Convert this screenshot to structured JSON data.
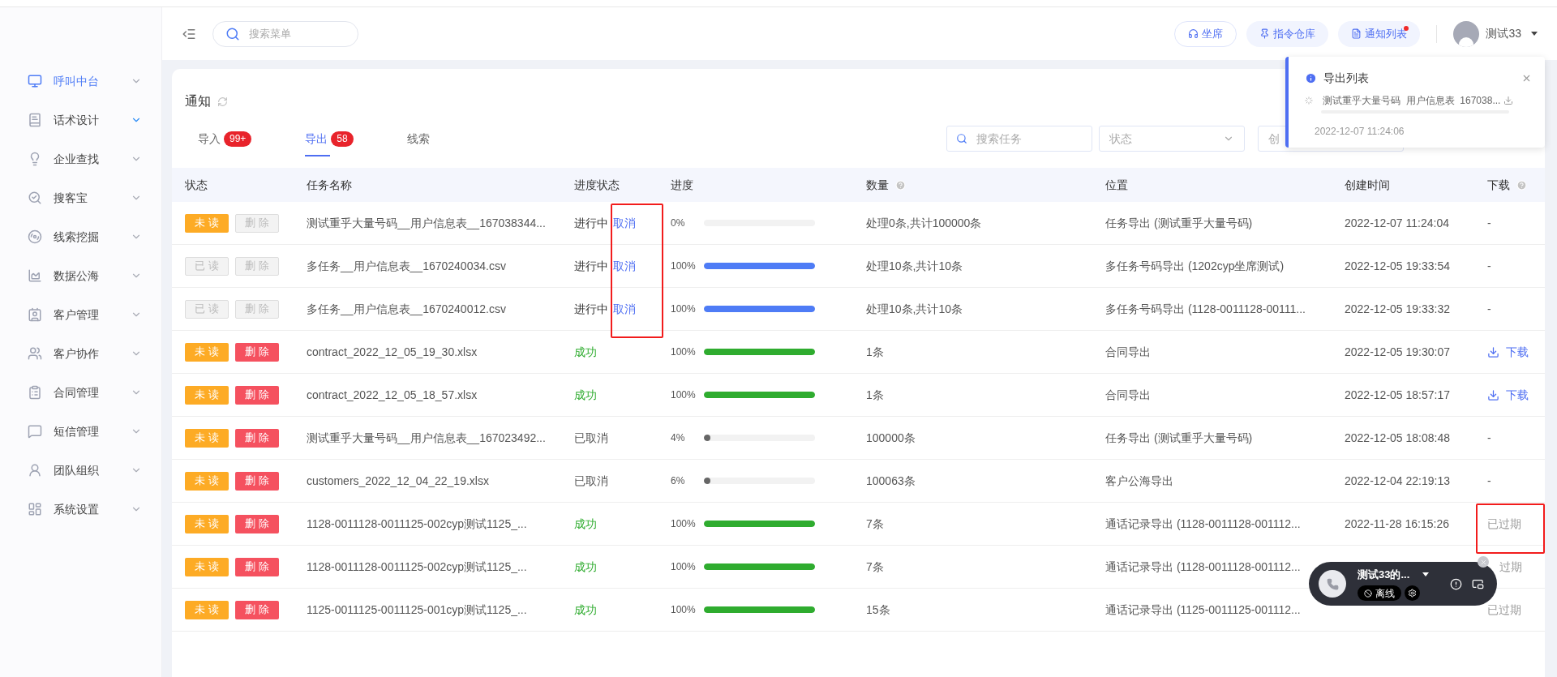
{
  "sidebar": {
    "items": [
      {
        "label": "呼叫中台",
        "selected": true,
        "chevron_highlighted": false
      },
      {
        "label": "话术设计",
        "selected": false,
        "chevron_highlighted": true
      },
      {
        "label": "企业查找",
        "selected": false,
        "chevron_highlighted": false
      },
      {
        "label": "搜客宝",
        "selected": false,
        "chevron_highlighted": false
      },
      {
        "label": "线索挖掘",
        "selected": false,
        "chevron_highlighted": false
      },
      {
        "label": "数据公海",
        "selected": false,
        "chevron_highlighted": false
      },
      {
        "label": "客户管理",
        "selected": false,
        "chevron_highlighted": false
      },
      {
        "label": "客户协作",
        "selected": false,
        "chevron_highlighted": false
      },
      {
        "label": "合同管理",
        "selected": false,
        "chevron_highlighted": false
      },
      {
        "label": "短信管理",
        "selected": false,
        "chevron_highlighted": false
      },
      {
        "label": "团队组织",
        "selected": false,
        "chevron_highlighted": false
      },
      {
        "label": "系统设置",
        "selected": false,
        "chevron_highlighted": false
      }
    ]
  },
  "header": {
    "search": {
      "placeholder": "搜索菜单"
    },
    "buttons": [
      {
        "label": "坐席",
        "kind": "outline",
        "dot": false
      },
      {
        "label": "指令仓库",
        "kind": "filled",
        "dot": false
      },
      {
        "label": "通知列表",
        "kind": "filled",
        "dot": true
      }
    ],
    "user": "测试33"
  },
  "page": {
    "title": "通知",
    "tabs": [
      {
        "label": "导入",
        "badge": "99+",
        "selected": false
      },
      {
        "label": "导出",
        "badge": "58",
        "selected": true
      },
      {
        "label": "线索",
        "selected": false
      }
    ],
    "filters": {
      "search": {
        "placeholder": "搜索任务"
      },
      "status": {
        "placeholder": "状态"
      },
      "date": {
        "placeholder": "创"
      }
    },
    "table": {
      "columns": [
        {
          "label": "状态"
        },
        {
          "label": "任务名称"
        },
        {
          "label": "进度状态"
        },
        {
          "label": "进度"
        },
        {
          "label": "数量",
          "help": true
        },
        {
          "label": "位置"
        },
        {
          "label": "创建时间"
        },
        {
          "label": "下载",
          "help": true
        }
      ],
      "rows": [
        {
          "read_label": "未读",
          "read": false,
          "delete_label": "删除",
          "delete_disabled": true,
          "name": "测试重乎大量号码__用户信息表__167038344...",
          "status": "进行中",
          "kind": "running",
          "cancel": "取消",
          "percent": "0%",
          "level": 0,
          "count": "处理0条,共计100000条",
          "location": "任务导出 (测试重乎大量号码)",
          "created": "2022-12-07 11:24:04",
          "download": {
            "kind": "none",
            "text": "-"
          }
        },
        {
          "read_label": "已读",
          "read": true,
          "delete_label": "删除",
          "delete_disabled": true,
          "name": "多任务__用户信息表__1670240034.csv",
          "status": "进行中",
          "kind": "running",
          "cancel": "取消",
          "percent": "100%",
          "level": 1,
          "count": "处理10条,共计10条",
          "location": "多任务号码导出 (1202cyp坐席测试)",
          "created": "2022-12-05 19:33:54",
          "download": {
            "kind": "none",
            "text": "-"
          }
        },
        {
          "read_label": "已读",
          "read": true,
          "delete_label": "删除",
          "delete_disabled": true,
          "name": "多任务__用户信息表__1670240012.csv",
          "status": "进行中",
          "kind": "running",
          "cancel": "取消",
          "percent": "100%",
          "level": 1,
          "count": "处理10条,共计10条",
          "location": "多任务号码导出 (1128-0011128-00111...",
          "created": "2022-12-05 19:33:32",
          "download": {
            "kind": "none",
            "text": "-"
          }
        },
        {
          "read_label": "未读",
          "read": false,
          "delete_label": "删除",
          "delete_disabled": false,
          "name": "contract_2022_12_05_19_30.xlsx",
          "status": "成功",
          "kind": "success",
          "percent": "100%",
          "level": 1,
          "count": "1条",
          "location": "合同导出",
          "created": "2022-12-05 19:30:07",
          "download": {
            "kind": "link",
            "text": "下载"
          }
        },
        {
          "read_label": "未读",
          "read": false,
          "delete_label": "删除",
          "delete_disabled": false,
          "name": "contract_2022_12_05_18_57.xlsx",
          "status": "成功",
          "kind": "success",
          "percent": "100%",
          "level": 1,
          "count": "1条",
          "location": "合同导出",
          "created": "2022-12-05 18:57:17",
          "download": {
            "kind": "link",
            "text": "下载"
          }
        },
        {
          "read_label": "未读",
          "read": false,
          "delete_label": "删除",
          "delete_disabled": false,
          "name": "测试重乎大量号码__用户信息表__167023492...",
          "status": "已取消",
          "kind": "cancelled",
          "percent": "4%",
          "level": 0.04,
          "count": "100000条",
          "location": "任务导出 (测试重乎大量号码)",
          "created": "2022-12-05 18:08:48",
          "download": {
            "kind": "none",
            "text": "-"
          }
        },
        {
          "read_label": "未读",
          "read": false,
          "delete_label": "删除",
          "delete_disabled": false,
          "name": "customers_2022_12_04_22_19.xlsx",
          "status": "已取消",
          "kind": "cancelled",
          "percent": "6%",
          "level": 0.06,
          "count": "100063条",
          "location": "客户公海导出",
          "created": "2022-12-04 22:19:13",
          "download": {
            "kind": "none",
            "text": "-"
          }
        },
        {
          "read_label": "未读",
          "read": false,
          "delete_label": "删除",
          "delete_disabled": false,
          "name": "1128-0011128-0011125-002cyp测试1125_...",
          "status": "成功",
          "kind": "success",
          "percent": "100%",
          "level": 1,
          "count": "7条",
          "location": "通话记录导出 (1128-0011128-001112...",
          "created": "2022-11-28 16:15:26",
          "download": {
            "kind": "expired",
            "text": "已过期"
          }
        },
        {
          "read_label": "未读",
          "read": false,
          "delete_label": "删除",
          "delete_disabled": false,
          "name": "1128-0011128-0011125-002cyp测试1125_...",
          "status": "成功",
          "kind": "success",
          "percent": "100%",
          "level": 1,
          "count": "7条",
          "location": "通话记录导出 (1128-0011128-001112...",
          "download": {
            "kind": "expired_partial",
            "text": "过期"
          }
        },
        {
          "read_label": "未读",
          "read": false,
          "delete_label": "删除",
          "delete_disabled": false,
          "name": "1125-0011125-0011125-001cyp测试1125_...",
          "status": "成功",
          "kind": "success",
          "percent": "100%",
          "level": 1,
          "count": "15条",
          "location": "通话记录导出 (1125-0011125-001112...",
          "download": {
            "kind": "expired",
            "text": "已过期"
          }
        }
      ]
    }
  },
  "export_popup": {
    "title": "导出列表",
    "item": "测试重乎大量号码  用户信息表  167038...",
    "level": 0,
    "time": "2022-12-07 11:24:06"
  },
  "call_widget": {
    "name": "测试33的...",
    "status": "离线"
  }
}
